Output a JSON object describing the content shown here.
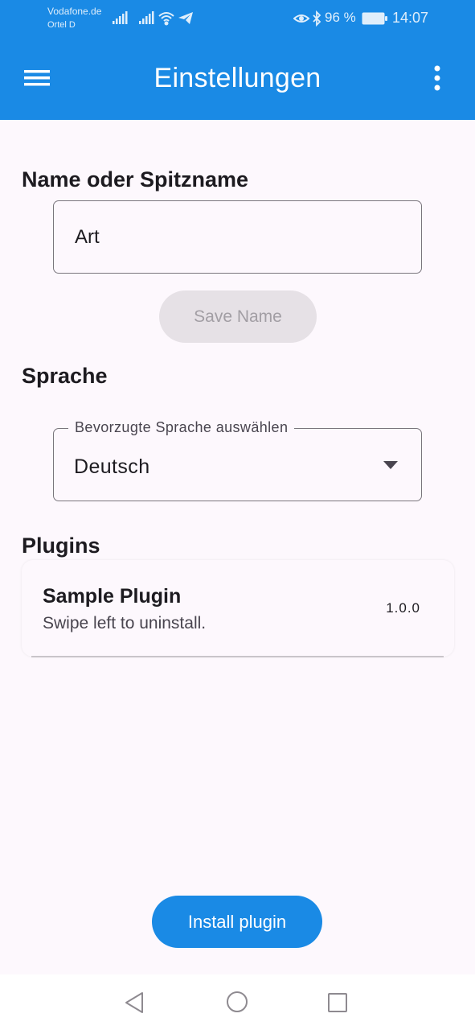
{
  "status_bar": {
    "carrier_line1": "Vodafone.de",
    "carrier_line2": "Ortel D",
    "battery": "96 %",
    "time": "14:07",
    "icons": [
      "signal-icon",
      "signal-icon",
      "wifi-icon",
      "telegram-icon",
      "eye-icon",
      "bluetooth-icon",
      "battery-icon"
    ]
  },
  "app_bar": {
    "title": "Einstellungen",
    "menu_icon": "hamburger-menu-icon",
    "overflow_icon": "more-vert-icon",
    "background_color": "#1a8ae5"
  },
  "name_section": {
    "heading": "Name oder Spitzname",
    "input_value": "Art",
    "save_label": "Save Name"
  },
  "language_section": {
    "heading": "Sprache",
    "field_label": "Bevorzugte Sprache auswählen",
    "selected": "Deutsch"
  },
  "plugins_section": {
    "heading": "Plugins",
    "items": [
      {
        "name": "Sample Plugin",
        "description": "Swipe left to uninstall.",
        "version": "1.0.0"
      }
    ],
    "install_label": "Install plugin"
  },
  "nav_bar": {
    "icons": [
      "back-icon",
      "home-icon",
      "recents-icon"
    ]
  }
}
